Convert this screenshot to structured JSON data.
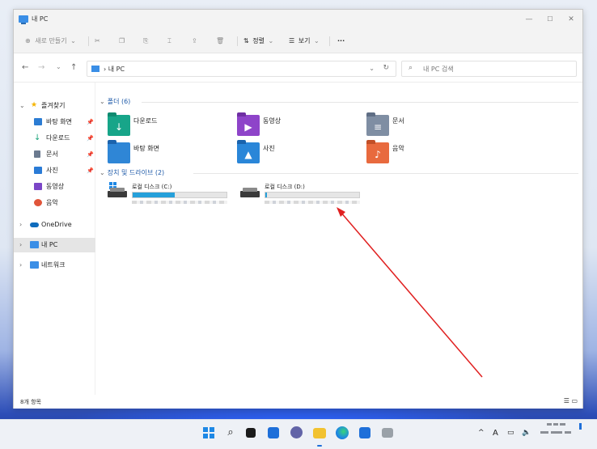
{
  "window": {
    "title": "내 PC",
    "controls": {
      "minimize": "—",
      "maximize": "☐",
      "close": "✕"
    }
  },
  "toolbar": {
    "new_label": "새로 만들기",
    "sort_label": "정렬",
    "view_label": "보기",
    "more_label": "···"
  },
  "address": {
    "crumb": "내 PC",
    "search_placeholder": "내 PC 검색"
  },
  "sidebar": {
    "quick_access": "즐겨찾기",
    "items": [
      {
        "label": "바탕 화면",
        "icon": "desktop-icon",
        "color": "#2b7cd3"
      },
      {
        "label": "다운로드",
        "icon": "download-icon",
        "color": "#1aa37a"
      },
      {
        "label": "문서",
        "icon": "document-icon",
        "color": "#6b7a8f"
      },
      {
        "label": "사진",
        "icon": "pictures-icon",
        "color": "#2a7bd6"
      },
      {
        "label": "동영상",
        "icon": "videos-icon",
        "color": "#7b46c7"
      },
      {
        "label": "음악",
        "icon": "music-icon",
        "color": "#e0553a"
      }
    ],
    "onedrive": "OneDrive",
    "this_pc": "내 PC",
    "network": "네트워크"
  },
  "main": {
    "folders_header": "폴더 (6)",
    "folders": [
      {
        "label": "다운로드",
        "color": "#17a589",
        "tab": "#0f8a70",
        "glyph": "↓"
      },
      {
        "label": "동영상",
        "color": "#8e44c9",
        "tab": "#6f2fa3",
        "glyph": "▶"
      },
      {
        "label": "문서",
        "color": "#7f8ea3",
        "tab": "#5f6e85",
        "glyph": "≡"
      },
      {
        "label": "바탕 화면",
        "color": "#2f86d6",
        "tab": "#1b63ad",
        "glyph": ""
      },
      {
        "label": "사진",
        "color": "#2a86d8",
        "tab": "#1a63ad",
        "glyph": "▲"
      },
      {
        "label": "음악",
        "color": "#e86a3e",
        "tab": "#c24f27",
        "glyph": "♪"
      }
    ],
    "drives_header": "장치 및 드라이브 (2)",
    "drives": [
      {
        "label": "로컬 디스크 (C:)",
        "usage": 0.45
      },
      {
        "label": "로컬 디스크 (D:)",
        "usage": 0.02
      }
    ]
  },
  "status": {
    "count": "8개 항목"
  },
  "tray": {
    "caret": "^",
    "ime": "A"
  },
  "annotation": {
    "color": "#e02020"
  }
}
